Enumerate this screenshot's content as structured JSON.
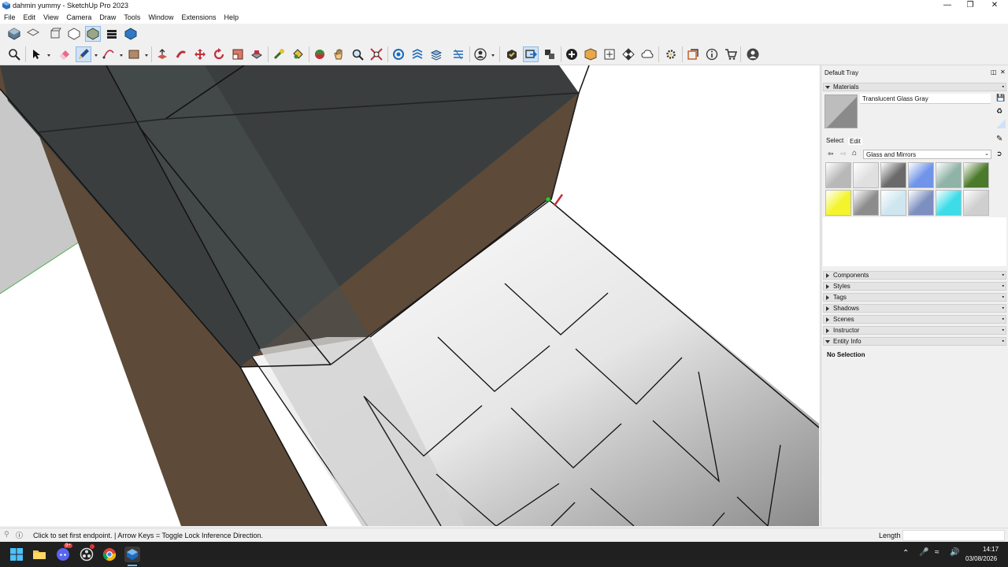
{
  "window": {
    "title": "dahmin yummy - SketchUp Pro 2023"
  },
  "menu": [
    "File",
    "Edit",
    "View",
    "Camera",
    "Draw",
    "Tools",
    "Window",
    "Extensions",
    "Help"
  ],
  "toolbar_top": {
    "icons": [
      "iso-view-icon",
      "top-view-icon",
      "front-view-icon",
      "right-view-icon",
      "back-view-icon",
      "left-view-icon",
      "bottom-view-icon"
    ]
  },
  "toolbar_main": {
    "icons": [
      "search-icon",
      "select-arrow-icon",
      "eraser-icon",
      "pencil-line-icon",
      "arc-icon",
      "rectangle-icon",
      "push-pull-icon",
      "follow-me-icon",
      "move-icon",
      "rotate-icon",
      "scale-icon",
      "offset-icon",
      "tape-measure-icon",
      "paint-bucket-icon",
      "orbit-icon",
      "pan-icon",
      "zoom-icon",
      "zoom-extents-icon",
      "section-plane-icon",
      "section-fill-icon",
      "terrain-icon",
      "sandbox-icon",
      "user-dropdown-icon",
      "warehouse-icon",
      "components-icon",
      "extension-manager-icon",
      "add-location-icon",
      "photo-texture-icon",
      "checker-icon",
      "cloud-icon",
      "settings-icon",
      "layout-icon",
      "info-icon",
      "cart-icon",
      "account-icon"
    ]
  },
  "tray": {
    "title": "Default Tray",
    "materials": {
      "label": "Materials",
      "current_material": "Translucent Glass Gray",
      "tab_select": "Select",
      "tab_edit": "Edit",
      "library": "Glass and Mirrors",
      "swatch_colors": [
        "#b8b8b8",
        "#e0e0e0",
        "#6a6a6a",
        "#6f94e8",
        "#8fb3a6",
        "#4b7a2a",
        "#f4f42a",
        "#8c8c8c",
        "#cfe6f0",
        "#7d8fc0",
        "#3cdce8",
        "#cfcfcf"
      ]
    },
    "sections": [
      "Components",
      "Styles",
      "Tags",
      "Shadows",
      "Scenes",
      "Instructor",
      "Entity Info"
    ],
    "entity_info": {
      "text": "No Selection"
    }
  },
  "status": {
    "message": "Click to set first endpoint. | Arrow Keys = Toggle Lock Inference Direction.",
    "measure_label": "Length",
    "measure_value": ""
  },
  "taskbar": {
    "discord_badge": "9+",
    "time": "14:17",
    "date": "03/08/2026"
  }
}
